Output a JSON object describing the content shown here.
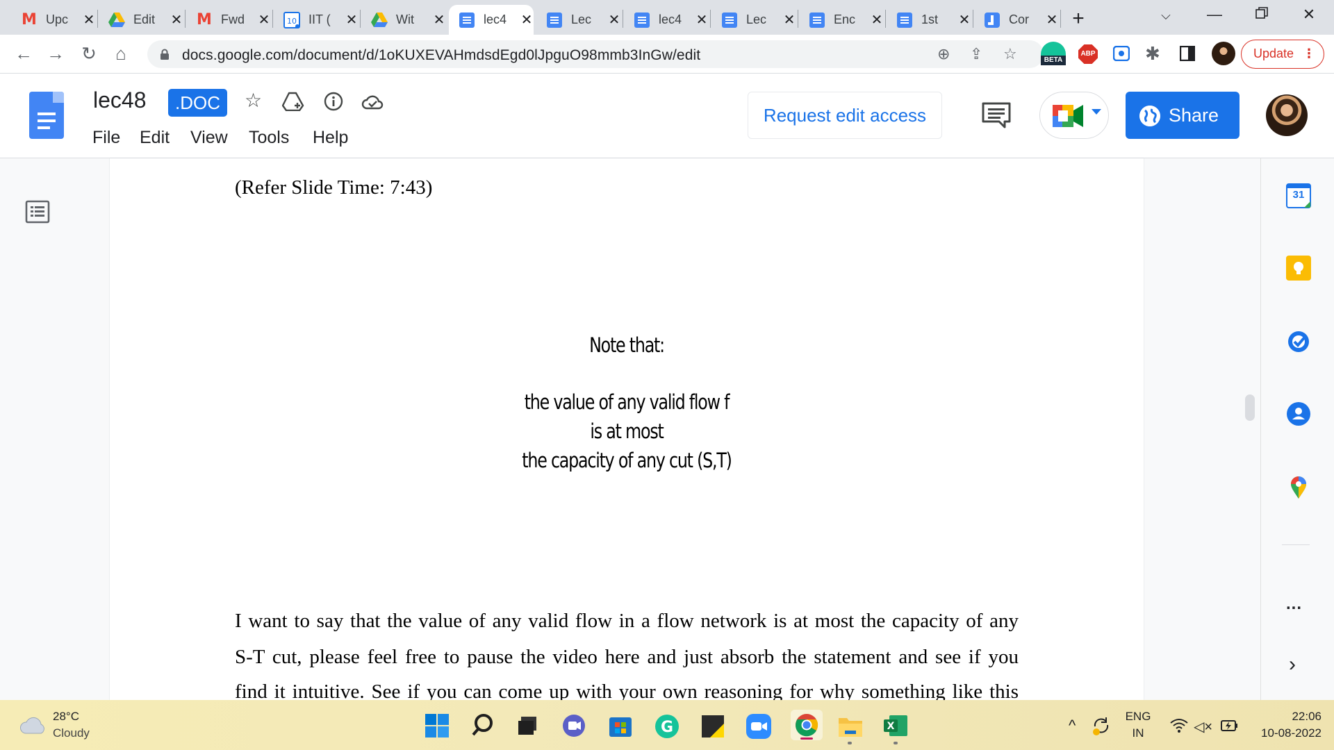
{
  "browser": {
    "tabs": [
      {
        "title": "Upc",
        "icon": "gmail-icon"
      },
      {
        "title": "Edit",
        "icon": "google-drive-icon"
      },
      {
        "title": "Fwd",
        "icon": "gmail-icon"
      },
      {
        "title": "IIT (",
        "icon": "calendar-icon"
      },
      {
        "title": "Wit",
        "icon": "google-drive-icon"
      },
      {
        "title": "lec4",
        "icon": "google-docs-icon",
        "active": true
      },
      {
        "title": "Lec",
        "icon": "google-docs-icon"
      },
      {
        "title": "lec4",
        "icon": "google-docs-icon"
      },
      {
        "title": "Lec",
        "icon": "google-docs-icon"
      },
      {
        "title": "Enc",
        "icon": "google-docs-icon"
      },
      {
        "title": "1st",
        "icon": "google-docs-icon"
      },
      {
        "title": "Cor",
        "icon": "jamboard-icon"
      }
    ],
    "url": "docs.google.com/document/d/1oKUXEVAHmdsdEgd0lJpguO98mmb3InGw/edit",
    "update_label": "Update",
    "beta_label": "BETA",
    "abp_label": "ABP"
  },
  "docs": {
    "title": "lec48",
    "badge": ".DOC",
    "menu": [
      "File",
      "Edit",
      "View",
      "Tools",
      "Help"
    ],
    "request_access_label": "Request edit access",
    "share_label": "Share"
  },
  "document": {
    "ref_time": "(Refer Slide Time: 7:43)",
    "slide_lines": [
      "Note that:",
      "the value of any valid flow f",
      "is at most",
      "the capacity of any cut (S,T)"
    ],
    "body_lines": [
      "I want to say that the value of any valid flow in a flow network is at most the capacity of any",
      "S-T cut, please feel free to pause the video here and just absorb the statement and see if you",
      "find it intuitive. See if you can come up with your own reasoning for why something like this"
    ]
  },
  "side_panel": {
    "calendar_day": "31",
    "more_label": "..."
  },
  "taskbar": {
    "weather_temp": "28°C",
    "weather_desc": "Cloudy",
    "lang_line1": "ENG",
    "lang_line2": "IN",
    "time": "22:06",
    "date": "10-08-2022"
  }
}
